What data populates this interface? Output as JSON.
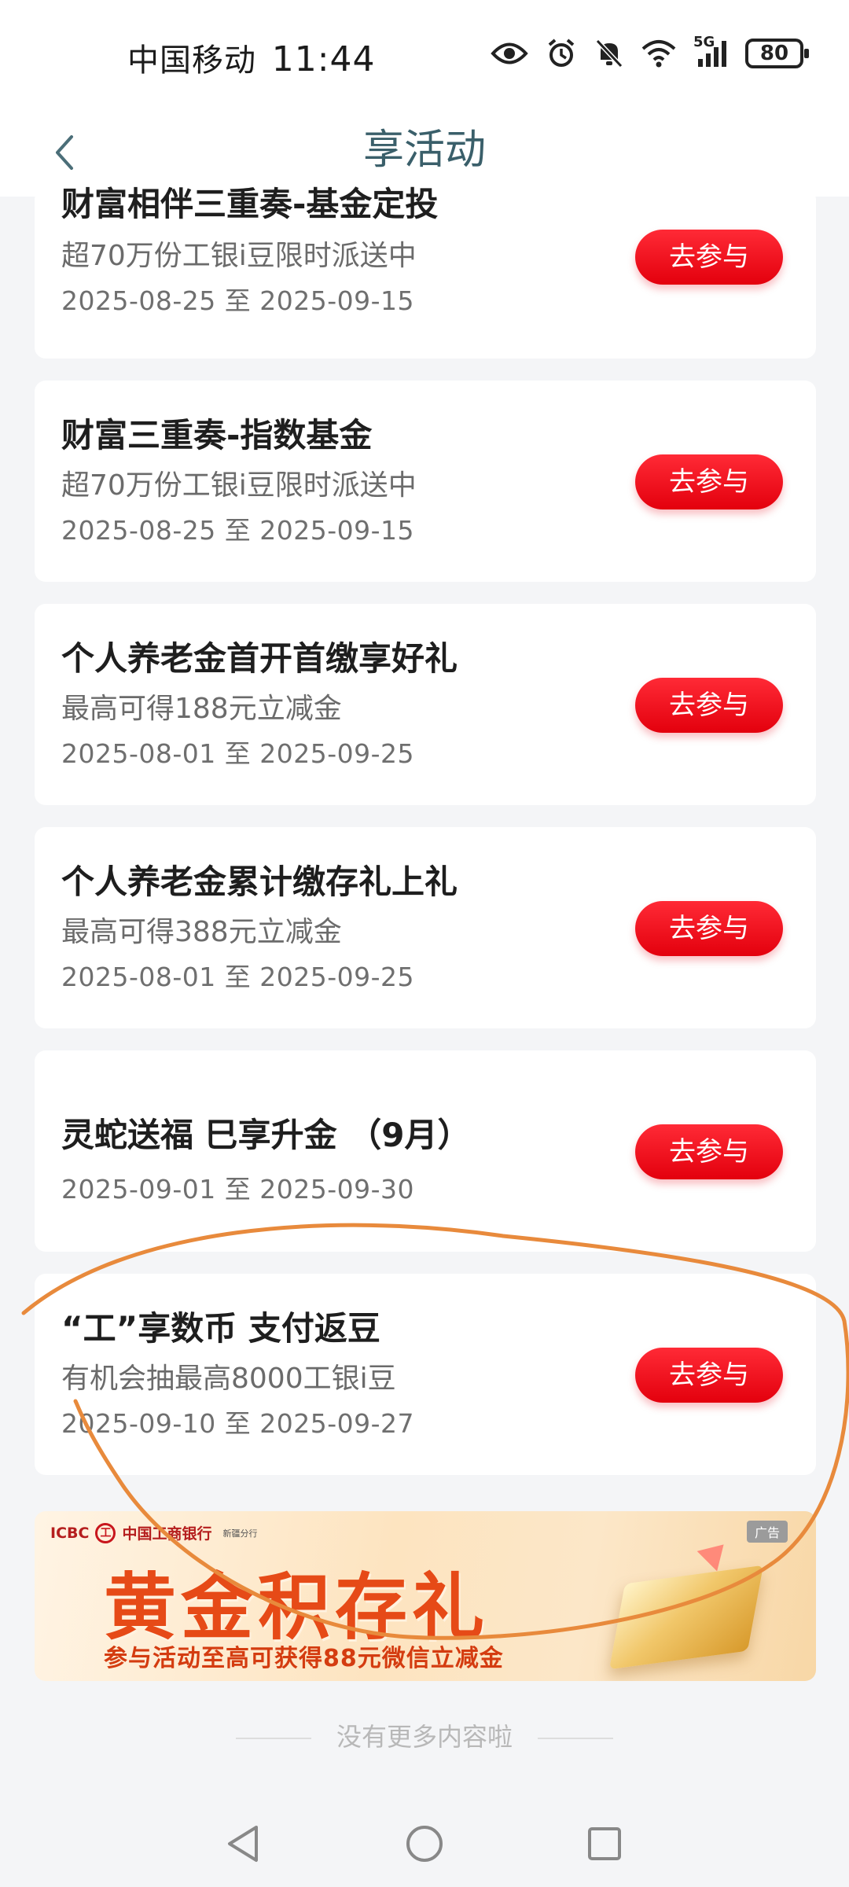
{
  "status_bar": {
    "carrier": "中国移动",
    "time": "11:44",
    "network": "5G",
    "battery": "80",
    "icons": [
      "eye-icon",
      "alarm-icon",
      "mute-icon",
      "wifi-icon",
      "signal-icon",
      "battery-icon"
    ]
  },
  "header": {
    "title": "享活动",
    "back_icon": "chevron-left-icon"
  },
  "activities": [
    {
      "title": "财富相伴三重奏-基金定投",
      "subtitle": "超70万份工银i豆限时派送中",
      "date": "2025-08-25 至 2025-09-15",
      "button": "去参与"
    },
    {
      "title": "财富三重奏-指数基金",
      "subtitle": "超70万份工银i豆限时派送中",
      "date": "2025-08-25 至 2025-09-15",
      "button": "去参与"
    },
    {
      "title": "个人养老金首开首缴享好礼",
      "subtitle": "最高可得188元立减金",
      "date": "2025-08-01 至 2025-09-25",
      "button": "去参与"
    },
    {
      "title": "个人养老金累计缴存礼上礼",
      "subtitle": "最高可得388元立减金",
      "date": "2025-08-01 至 2025-09-25",
      "button": "去参与"
    },
    {
      "title": "灵蛇送福 巳享升金 （9月）",
      "subtitle": "",
      "date": "2025-09-01 至 2025-09-30",
      "button": "去参与"
    },
    {
      "title": "“工”享数币 支付返豆",
      "subtitle": "有机会抽最高8000工银i豆",
      "date": "2025-09-10 至 2025-09-27",
      "button": "去参与"
    }
  ],
  "banner": {
    "logo_text": "ICBC",
    "bank_name": "中国工商银行",
    "branch": "新疆分行",
    "ad_tag": "广告",
    "title": "黄金积存礼",
    "subtitle": "参与活动至高可获得88元微信立减金"
  },
  "footer": {
    "no_more": "没有更多内容啦"
  },
  "colors": {
    "accent_red": "#e3000d",
    "header_title": "#3a5f6a",
    "annotation_orange": "#e88a3c"
  }
}
